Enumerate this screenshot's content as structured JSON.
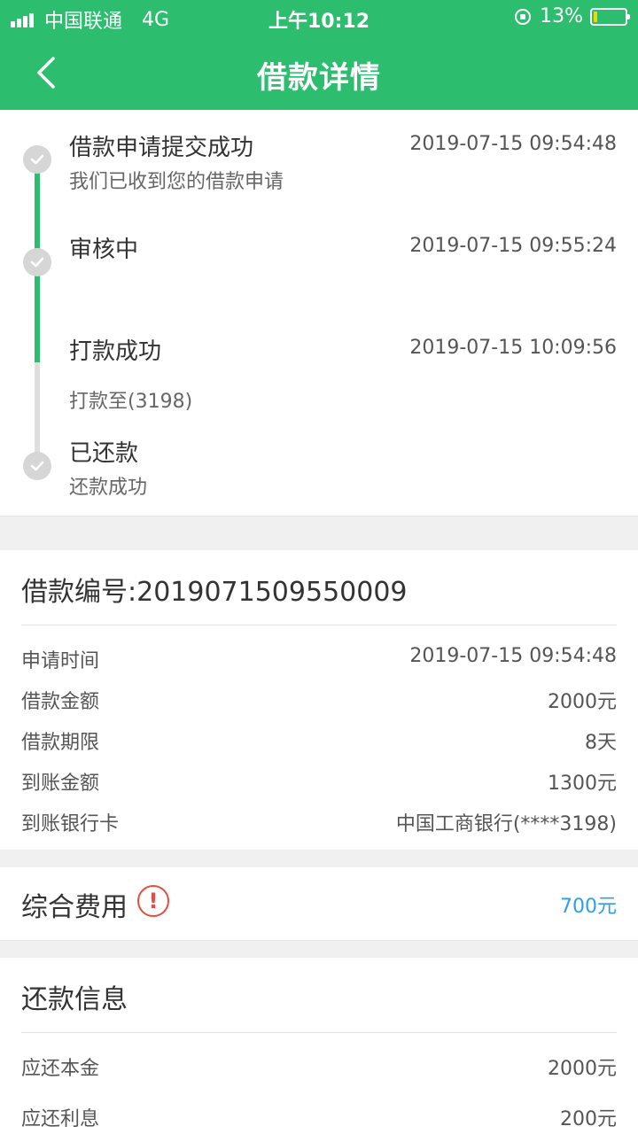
{
  "status_bar": {
    "carrier": "中国联通",
    "network": "4G",
    "time": "上午10:12",
    "battery_text": "13%",
    "battery_level": 0.13
  },
  "nav": {
    "title": "借款详情",
    "back_icon": "chevron-left-icon"
  },
  "timeline": [
    {
      "title": "借款申请提交成功",
      "subtitle": "我们已收到您的借款申请",
      "time": "2019-07-15 09:54:48",
      "done": true
    },
    {
      "title": "审核中",
      "subtitle": "",
      "time": "2019-07-15 09:55:24",
      "done": true
    },
    {
      "title": "打款成功",
      "subtitle": "打款至(3198)",
      "time": "2019-07-15 10:09:56",
      "done": false
    },
    {
      "title": "已还款",
      "subtitle": "还款成功",
      "time": "",
      "done": true
    }
  ],
  "loan": {
    "number_label": "借款编号:2019071509550009",
    "rows": [
      {
        "label": "申请时间",
        "value": "2019-07-15 09:54:48"
      },
      {
        "label": "借款金额",
        "value": "2000元"
      },
      {
        "label": "借款期限",
        "value": "8天"
      },
      {
        "label": "到账金额",
        "value": "1300元"
      },
      {
        "label": "到账银行卡",
        "value": "中国工商银行(****3198)"
      }
    ]
  },
  "fees": {
    "label": "综合费用",
    "value": "700元",
    "icon": "alert-icon"
  },
  "repayment": {
    "title": "还款信息",
    "rows": [
      {
        "label": "应还本金",
        "value": "2000元"
      },
      {
        "label": "应还利息",
        "value": "200元"
      }
    ]
  },
  "colors": {
    "brand_green": "#2dbd6e",
    "link_blue": "#2e9fe6",
    "alert_red": "#e74c3c",
    "battery_yellow": "#f5d400"
  }
}
